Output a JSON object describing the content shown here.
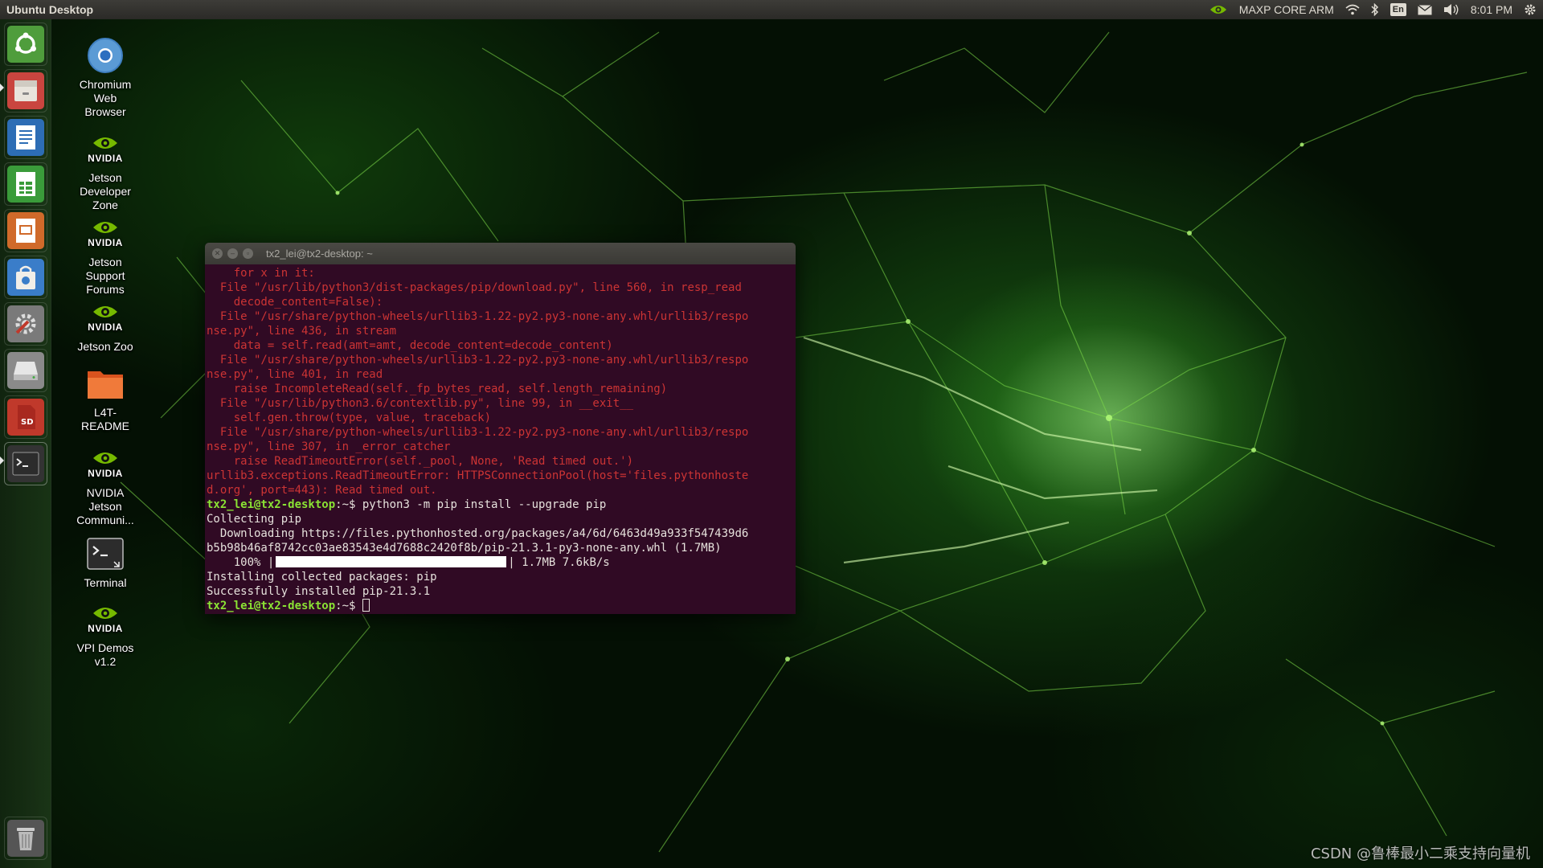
{
  "top_panel": {
    "title": "Ubuntu Desktop",
    "power_mode": "MAXP CORE ARM",
    "language": "En",
    "clock": "8:01 PM",
    "icons": [
      "nvidia-icon",
      "wifi-icon",
      "bluetooth-icon",
      "mail-icon",
      "volume-icon",
      "gear-icon"
    ]
  },
  "launcher": {
    "items": [
      {
        "name": "launcher-dash-home",
        "icon": "ubuntu-logo-icon",
        "color": "#4f9d3c"
      },
      {
        "name": "launcher-files",
        "icon": "file-cabinet-icon",
        "color": "#c9453f"
      },
      {
        "name": "launcher-libreoffice-writer",
        "icon": "document-icon",
        "color": "#2d6db5"
      },
      {
        "name": "launcher-libreoffice-calc",
        "icon": "spreadsheet-icon",
        "color": "#3a9b3a"
      },
      {
        "name": "launcher-libreoffice-impress",
        "icon": "presentation-icon",
        "color": "#d06a2a"
      },
      {
        "name": "launcher-software-center",
        "icon": "shopping-bag-icon",
        "color": "#3a7dc9"
      },
      {
        "name": "launcher-system-settings",
        "icon": "settings-icon",
        "color": "#7a7a7a"
      },
      {
        "name": "launcher-drive",
        "icon": "drive-icon",
        "color": "#8a8a8a"
      },
      {
        "name": "launcher-sd-card",
        "icon": "sd-card-icon",
        "color": "#c0392b"
      },
      {
        "name": "launcher-terminal",
        "icon": "terminal-icon",
        "color": "#333333"
      },
      {
        "name": "launcher-trash",
        "icon": "trash-icon",
        "color": "#555555"
      }
    ]
  },
  "desktop_icons": [
    {
      "label": "Chromium\nWeb\nBrowser",
      "icon": "chromium-icon"
    },
    {
      "label": "Jetson\nDeveloper\nZone",
      "icon": "nvidia-icon"
    },
    {
      "label": "Jetson\nSupport\nForums",
      "icon": "nvidia-icon"
    },
    {
      "label": "Jetson Zoo",
      "icon": "nvidia-icon"
    },
    {
      "label": "L4T-\nREADME",
      "icon": "folder-icon"
    },
    {
      "label": "NVIDIA\nJetson\nCommuni...",
      "icon": "nvidia-icon"
    },
    {
      "label": "Terminal",
      "icon": "terminal-icon"
    },
    {
      "label": "VPI Demos\nv1.2",
      "icon": "nvidia-icon"
    }
  ],
  "nvidia_word": "NVIDIA",
  "terminal": {
    "title": "tx2_lei@tx2-desktop: ~",
    "error_lines": [
      "    for x in it:",
      "  File \"/usr/lib/python3/dist-packages/pip/download.py\", line 560, in resp_read",
      "    decode_content=False):",
      "  File \"/usr/share/python-wheels/urllib3-1.22-py2.py3-none-any.whl/urllib3/respo",
      "nse.py\", line 436, in stream",
      "    data = self.read(amt=amt, decode_content=decode_content)",
      "  File \"/usr/share/python-wheels/urllib3-1.22-py2.py3-none-any.whl/urllib3/respo",
      "nse.py\", line 401, in read",
      "    raise IncompleteRead(self._fp_bytes_read, self.length_remaining)",
      "  File \"/usr/lib/python3.6/contextlib.py\", line 99, in __exit__",
      "    self.gen.throw(type, value, traceback)",
      "  File \"/usr/share/python-wheels/urllib3-1.22-py2.py3-none-any.whl/urllib3/respo",
      "nse.py\", line 307, in _error_catcher",
      "    raise ReadTimeoutError(self._pool, None, 'Read timed out.')",
      "urllib3.exceptions.ReadTimeoutError: HTTPSConnectionPool(host='files.pythonhoste",
      "d.org', port=443): Read timed out."
    ],
    "prompt": "tx2_lei@tx2-desktop",
    "prompt_suffix": ":~$ ",
    "command": "python3 -m pip install --upgrade pip",
    "output_lines": [
      "Collecting pip",
      "  Downloading https://files.pythonhosted.org/packages/a4/6d/6463d49a933f547439d6",
      "b5b98b46af8742cc03ae83543e4d7688c2420f8b/pip-21.3.1-py3-none-any.whl (1.7MB)"
    ],
    "progress": {
      "percent_label": "    100% |",
      "fraction": 1.0,
      "suffix": "| 1.7MB 7.6kB/s"
    },
    "final_lines": [
      "Installing collected packages: pip",
      "Successfully installed pip-21.3.1"
    ]
  },
  "watermark": "CSDN @鲁棒最小二乘支持向量机"
}
